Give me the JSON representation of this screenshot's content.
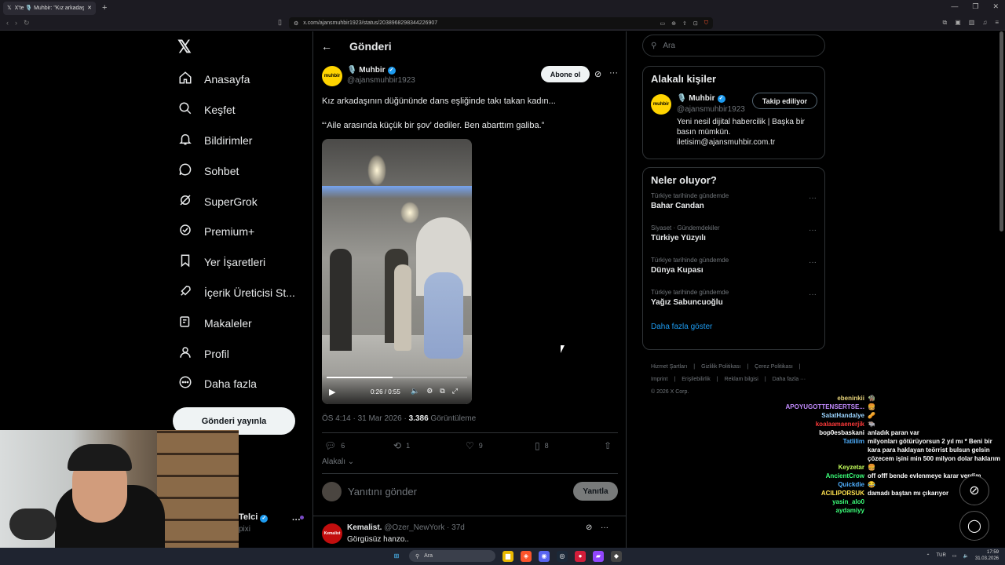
{
  "browser": {
    "tab_title": "X'te 🎙️ Muhbir: \"Kız arkadaşının...",
    "url": "x.com/ajansmuhbir1923/status/2038968298344226907"
  },
  "nav": {
    "logo": "𝕏",
    "items": [
      {
        "label": "Anasayfa",
        "icon": "home-icon"
      },
      {
        "label": "Keşfet",
        "icon": "search-icon"
      },
      {
        "label": "Bildirimler",
        "icon": "bell-icon"
      },
      {
        "label": "Sohbet",
        "icon": "chat-icon"
      },
      {
        "label": "SuperGrok",
        "icon": "grok-icon"
      },
      {
        "label": "Premium+",
        "icon": "premium-icon"
      },
      {
        "label": "Yer İşaretleri",
        "icon": "bookmark-icon"
      },
      {
        "label": "İçerik Üreticisi St...",
        "icon": "rocket-icon"
      },
      {
        "label": "Makaleler",
        "icon": "article-icon"
      },
      {
        "label": "Profil",
        "icon": "person-icon"
      },
      {
        "label": "Daha fazla",
        "icon": "more-circle-icon"
      }
    ],
    "post_button": "Gönderi yayınla",
    "account_name": "Telci",
    "account_handle": "pixi"
  },
  "header": {
    "title": "Gönderi"
  },
  "tweet": {
    "author_name": "🎙️ Muhbir",
    "author_handle": "@ajansmuhbir1923",
    "avatar_text": "muhbir",
    "follow_label": "Abone ol",
    "text_line1": "Kız arkadaşının düğününde dans eşliğinde takı takan kadın...",
    "text_line2": "“‘Aile arasında küçük bir şov’ dediler. Ben abarttım galiba.”",
    "video_time": "0:26 / 0:55",
    "video_progress": 0.47,
    "time": "ÖS 4:14 · 31 Mar 2026 · ",
    "views": "3.386",
    "views_label": " Görüntüleme",
    "replies": "6",
    "retweets": "1",
    "likes": "9",
    "bookmarks": "8",
    "related_label": "Alakalı"
  },
  "reply_box": {
    "placeholder": "Yanıtını gönder",
    "button": "Yanıtla"
  },
  "reply": {
    "name": "Kemalist.",
    "handle": "@Ozer_NewYork · 37d",
    "avatar_text": "Kemalist",
    "text": "Görgüsüz hanzo.."
  },
  "search": {
    "placeholder": "Ara"
  },
  "related": {
    "title": "Alakalı kişiler",
    "name": "🎙️ Muhbir",
    "handle": "@ajansmuhbir1923",
    "button": "Takip ediliyor",
    "bio": "Yeni nesil dijital habercilik | Başka bir basın mümkün. iletisim@ajansmuhbir.com.tr"
  },
  "trends": {
    "title": "Neler oluyor?",
    "items": [
      {
        "context": "Türkiye tarihinde gündemde",
        "title": "Bahar Candan"
      },
      {
        "context": "Siyaset · Gündemdekiler",
        "title": "Türkiye Yüzyılı"
      },
      {
        "context": "Türkiye tarihinde gündemde",
        "title": "Dünya Kupası"
      },
      {
        "context": "Türkiye tarihinde gündemde",
        "title": "Yağız Sabuncuoğlu"
      }
    ],
    "show_more": "Daha fazla göster"
  },
  "footer": {
    "links": [
      "Hizmet Şartları",
      "|",
      "Gizlilik Politikası",
      "|",
      "Çerez Politikası",
      "|",
      "Imprint",
      "|",
      "Erişilebilirlik",
      "|",
      "Reklam bilgisi",
      "|",
      "Daha fazla ···"
    ],
    "copyright": "© 2026 X Corp."
  },
  "chat": [
    {
      "user": "ebeninkii",
      "text": "🧌",
      "color": "#e7d37a"
    },
    {
      "user": "APOYUGOTTENSERTSE...",
      "text": "🍔",
      "color": "#c38bff"
    },
    {
      "user": "SalatHandalye",
      "text": "🥜",
      "color": "#9ad4ff"
    },
    {
      "user": "koalaamaenerjik",
      "text": "🐃",
      "color": "#ff3a3a"
    },
    {
      "user": "bop0esbaskani",
      "text": "anladık paran var",
      "color": "#ffffff"
    },
    {
      "user": "Tatlilim",
      "text": "milyonları götürüyorsun 2 yıl mı * Beni bir kara para haklayan teörrist bulsun gelsin çözecem işini min 500 milyon dolar haklarım",
      "color": "#4fb0ff"
    },
    {
      "user": "Keyzetar",
      "text": "🍔",
      "color": "#c5ff5c"
    },
    {
      "user": "AncientCrow",
      "text": "off offf bende evlenmeye karar verdim",
      "color": "#3cff7a"
    },
    {
      "user": "Quickdie",
      "text": "😂",
      "color": "#4fb0ff"
    },
    {
      "user": "ACILIPORSUK",
      "text": "damadı baştan mı çıkarıyor",
      "color": "#ffe14f"
    },
    {
      "user": "yasin_alo0",
      "text": "",
      "color": "#3cff7a"
    },
    {
      "user": "aydamiyy",
      "text": "",
      "color": "#3cff7a"
    }
  ],
  "taskbar": {
    "search": "Ara",
    "lang": "TUR",
    "time": "17:59",
    "date": "31.03.2026"
  },
  "colors": {
    "accent": "#1d9bf0",
    "background": "#000000",
    "brand_yellow": "#ffd400"
  }
}
